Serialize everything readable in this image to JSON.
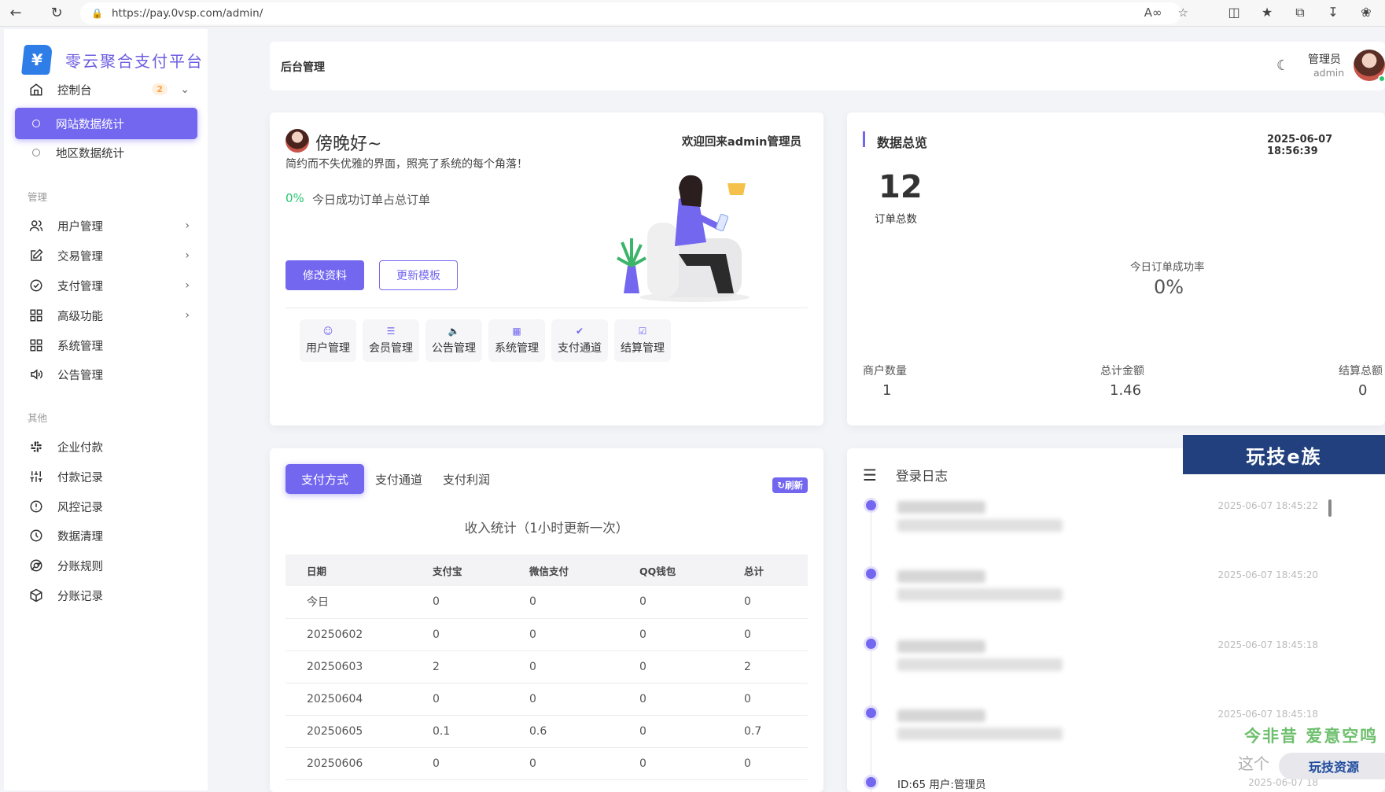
{
  "browser": {
    "url": "https://pay.0vsp.com/admin/"
  },
  "sidebar": {
    "logo_text": "零云聚合支付平台",
    "dashboard": {
      "label": "控制台",
      "badge": "2"
    },
    "sub_items": [
      {
        "label": "网站数据统计",
        "active": true
      },
      {
        "label": "地区数据统计",
        "active": false
      }
    ],
    "section_manage": "管理",
    "manage_items": [
      {
        "label": "用户管理",
        "icon": "users-icon"
      },
      {
        "label": "交易管理",
        "icon": "edit-icon"
      },
      {
        "label": "支付管理",
        "icon": "check-circle-icon"
      },
      {
        "label": "高级功能",
        "icon": "grid-icon"
      },
      {
        "label": "系统管理",
        "icon": "grid-icon"
      },
      {
        "label": "公告管理",
        "icon": "speaker-icon"
      }
    ],
    "section_other": "其他",
    "other_items": [
      {
        "label": "企业付款",
        "icon": "slack-icon"
      },
      {
        "label": "付款记录",
        "icon": "sliders-icon"
      },
      {
        "label": "风控记录",
        "icon": "alert-circle-icon"
      },
      {
        "label": "数据清理",
        "icon": "clock-icon"
      },
      {
        "label": "分账规则",
        "icon": "chrome-icon"
      },
      {
        "label": "分账记录",
        "icon": "codesandbox-icon"
      }
    ]
  },
  "header": {
    "title": "后台管理",
    "user_name": "管理员",
    "user_sub": "admin"
  },
  "welcome": {
    "greeting": "傍晚好~",
    "welcome_text": "欢迎回来admin管理员",
    "slogan": "简约而不失优雅的界面，照亮了系统的每个角落！",
    "rate": "0%",
    "rate_label": "今日成功订单占总订单",
    "btn_edit": "修改资料",
    "btn_template": "更新模板",
    "quick_links": [
      {
        "label": "用户管理",
        "icon": "user-icon"
      },
      {
        "label": "会员管理",
        "icon": "layers-icon"
      },
      {
        "label": "公告管理",
        "icon": "speaker-icon"
      },
      {
        "label": "系统管理",
        "icon": "grid-icon"
      },
      {
        "label": "支付通道",
        "icon": "check-circle-icon"
      },
      {
        "label": "结算管理",
        "icon": "check-square-icon"
      }
    ]
  },
  "overview": {
    "title": "数据总览",
    "datetime": "2025-06-07 18:56:39",
    "order_total": "12",
    "order_total_label": "订单总数",
    "success_rate_label": "今日订单成功率",
    "success_rate": "0%",
    "merchants_label": "商户数量",
    "merchants": "1",
    "amount_label": "总计金额",
    "amount": "1.46",
    "settle_label": "结算总额",
    "settle": "0"
  },
  "stats": {
    "tabs": [
      "支付方式",
      "支付通道",
      "支付利润"
    ],
    "refresh_label": "刷新",
    "title": "收入统计（1小时更新一次）",
    "columns": [
      "日期",
      "支付宝",
      "微信支付",
      "QQ钱包",
      "总计"
    ],
    "rows": [
      [
        "今日",
        "0",
        "0",
        "0",
        "0"
      ],
      [
        "20250602",
        "0",
        "0",
        "0",
        "0"
      ],
      [
        "20250603",
        "2",
        "0",
        "0",
        "2"
      ],
      [
        "20250604",
        "0",
        "0",
        "0",
        "0"
      ],
      [
        "20250605",
        "0.1",
        "0.6",
        "0",
        "0.7"
      ],
      [
        "20250606",
        "0",
        "0",
        "0",
        "0"
      ]
    ]
  },
  "login_log": {
    "title": "登录日志",
    "entries": [
      {
        "time": "2025-06-07 18:45:22"
      },
      {
        "time": "2025-06-07 18:45:20"
      },
      {
        "time": "2025-06-07 18:45:18"
      },
      {
        "time": "2025-06-07 18:45:18"
      },
      {
        "time": "2025-06-07 18",
        "text": "ID:65 用户:管理员"
      }
    ]
  },
  "watermarks": {
    "banner": "玩技e族",
    "green": "今非昔 爱意空鸣",
    "gray": "这个",
    "pill": "玩技资源"
  }
}
